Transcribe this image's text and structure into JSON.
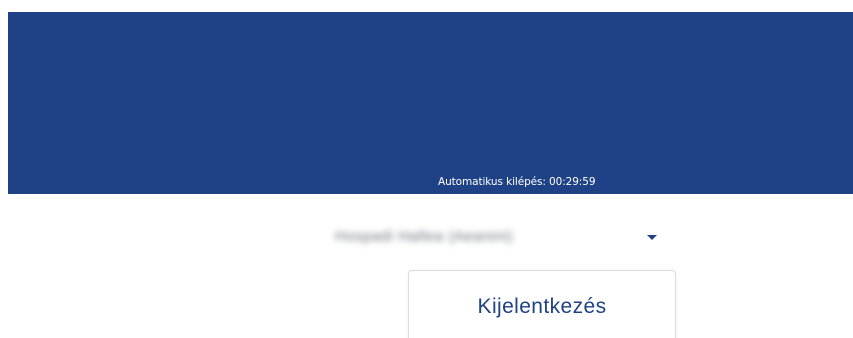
{
  "header": {
    "auto_logout_label": "Automatikus kilépés: 00:29:59",
    "background_color": "#1f4185"
  },
  "user_menu": {
    "user_name": "Hospadi Hallea (Aeanini)",
    "dropdown_icon": "caret-down-icon",
    "items": [
      {
        "label": "Kijelentkezés"
      }
    ]
  }
}
